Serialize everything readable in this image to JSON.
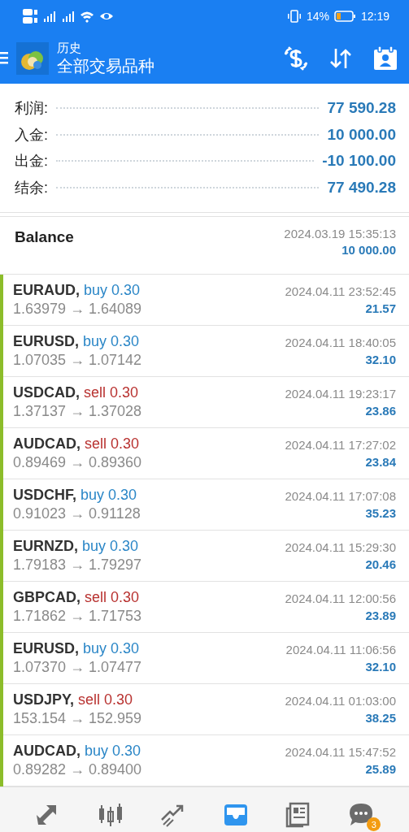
{
  "status_bar": {
    "battery": "14%",
    "time": "12:19"
  },
  "app_bar": {
    "title": "历史",
    "subtitle": "全部交易品种"
  },
  "summary": [
    {
      "label": "利润:",
      "value": "77 590.28"
    },
    {
      "label": "入金:",
      "value": "10 000.00"
    },
    {
      "label": "出金:",
      "value": "-10 100.00"
    },
    {
      "label": "结余:",
      "value": "77 490.28"
    }
  ],
  "balance": {
    "label": "Balance",
    "time": "2024.03.19 15:35:13",
    "amount": "10 000.00"
  },
  "deals": [
    {
      "symbol": "EURAUD,",
      "kind": "buy",
      "order": "buy 0.30",
      "prices": "1.63979 → 1.64089",
      "time": "2024.04.11 23:52:45",
      "profit": "21.57"
    },
    {
      "symbol": "EURUSD,",
      "kind": "buy",
      "order": "buy 0.30",
      "prices": "1.07035 → 1.07142",
      "time": "2024.04.11 18:40:05",
      "profit": "32.10"
    },
    {
      "symbol": "USDCAD,",
      "kind": "sell",
      "order": "sell 0.30",
      "prices": "1.37137 → 1.37028",
      "time": "2024.04.11 19:23:17",
      "profit": "23.86"
    },
    {
      "symbol": "AUDCAD,",
      "kind": "sell",
      "order": "sell 0.30",
      "prices": "0.89469 → 0.89360",
      "time": "2024.04.11 17:27:02",
      "profit": "23.84"
    },
    {
      "symbol": "USDCHF,",
      "kind": "buy",
      "order": "buy 0.30",
      "prices": "0.91023 → 0.91128",
      "time": "2024.04.11 17:07:08",
      "profit": "35.23"
    },
    {
      "symbol": "EURNZD,",
      "kind": "buy",
      "order": "buy 0.30",
      "prices": "1.79183 → 1.79297",
      "time": "2024.04.11 15:29:30",
      "profit": "20.46"
    },
    {
      "symbol": "GBPCAD,",
      "kind": "sell",
      "order": "sell 0.30",
      "prices": "1.71862 → 1.71753",
      "time": "2024.04.11 12:00:56",
      "profit": "23.89"
    },
    {
      "symbol": "EURUSD,",
      "kind": "buy",
      "order": "buy 0.30",
      "prices": "1.07370 → 1.07477",
      "time": "2024.04.11 11:06:56",
      "profit": "32.10"
    },
    {
      "symbol": "USDJPY,",
      "kind": "sell",
      "order": "sell 0.30",
      "prices": "153.154 → 152.959",
      "time": "2024.04.11 01:03:00",
      "profit": "38.25"
    },
    {
      "symbol": "AUDCAD,",
      "kind": "buy",
      "order": "buy 0.30",
      "prices": "0.89282 → 0.89400",
      "time": "2024.04.11 15:47:52",
      "profit": "25.89"
    }
  ],
  "nav": [
    {
      "kind": "trade",
      "selected": false
    },
    {
      "kind": "candles",
      "selected": false
    },
    {
      "kind": "trend",
      "selected": false
    },
    {
      "kind": "inbox",
      "selected": true
    },
    {
      "kind": "news",
      "selected": false
    },
    {
      "kind": "chat",
      "selected": false,
      "badge": "3"
    }
  ]
}
